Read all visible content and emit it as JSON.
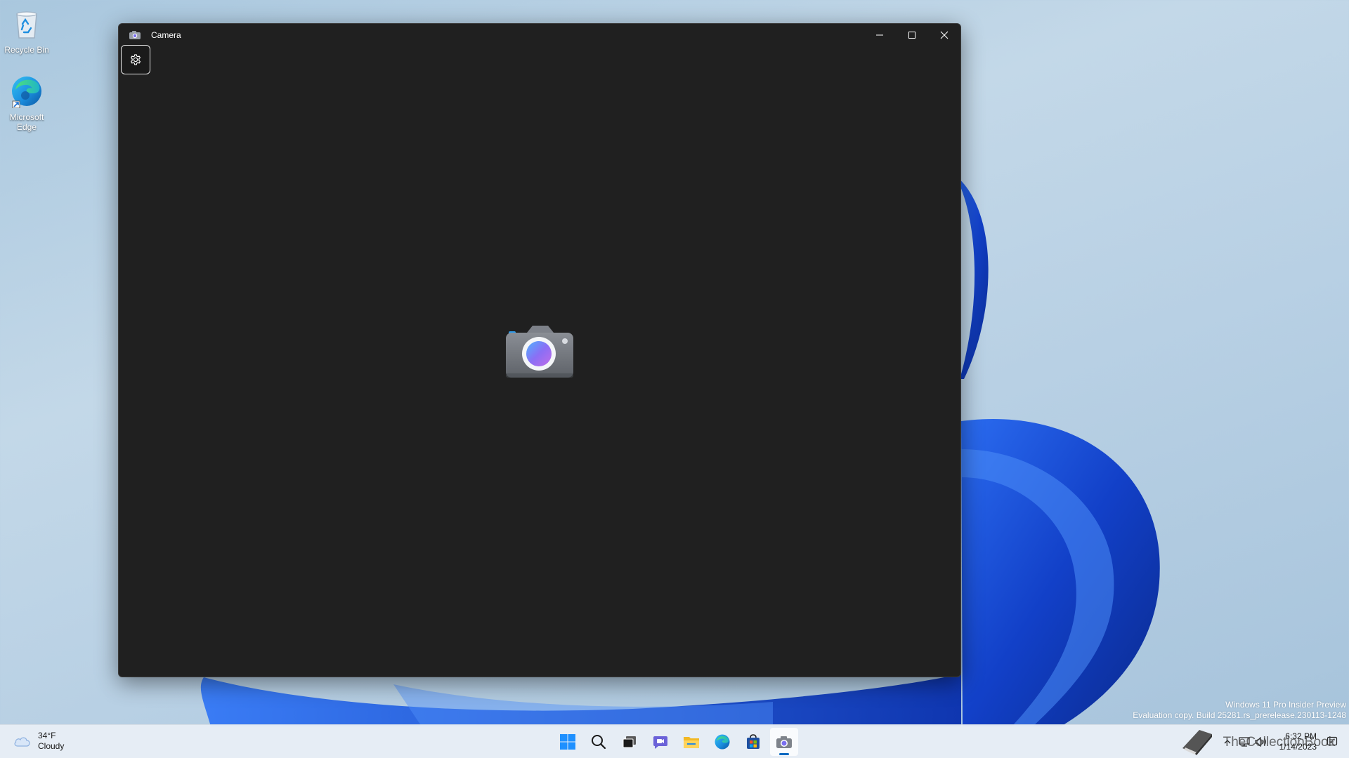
{
  "desktop": {
    "icons": [
      {
        "label": "Recycle Bin",
        "icon": "recycle-bin-icon"
      },
      {
        "label": "Microsoft Edge",
        "icon": "edge-icon"
      }
    ]
  },
  "window": {
    "title": "Camera",
    "app_icon": "camera-icon",
    "controls": {
      "minimize": "minimize-icon",
      "maximize": "maximize-icon",
      "close": "close-icon"
    },
    "settings_icon": "gear-icon"
  },
  "watermark": {
    "line1": "Windows 11 Pro Insider Preview",
    "line2": "Evaluation copy. Build 25281.rs_prerelease.230113-1248"
  },
  "taskbar": {
    "weather": {
      "temperature": "34°F",
      "condition": "Cloudy"
    },
    "pinned": [
      {
        "name": "start",
        "icon": "windows-start-icon"
      },
      {
        "name": "search",
        "icon": "search-icon"
      },
      {
        "name": "task-view",
        "icon": "task-view-icon"
      },
      {
        "name": "teams-chat",
        "icon": "chat-icon"
      },
      {
        "name": "file-explorer",
        "icon": "folder-icon"
      },
      {
        "name": "edge",
        "icon": "edge-icon"
      },
      {
        "name": "store",
        "icon": "store-icon"
      },
      {
        "name": "camera",
        "icon": "camera-icon",
        "active": true
      }
    ],
    "tray": {
      "overlay_text": "TheCollectionBook",
      "time": "6:32 PM",
      "date": "1/14/2023"
    }
  },
  "colors": {
    "window_bg": "#202020",
    "taskbar_bg": "#e8eef6",
    "accent": "#0067c0",
    "bloom": "#1347d6"
  }
}
